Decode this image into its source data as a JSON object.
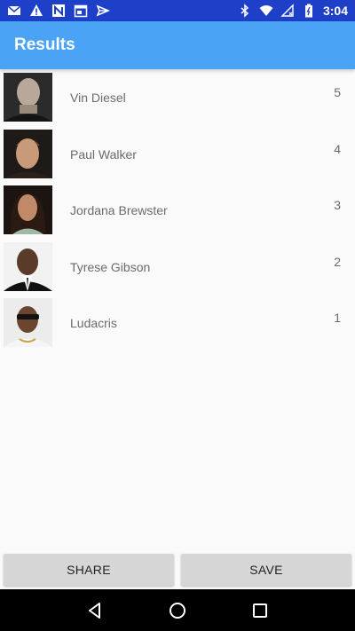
{
  "status_bar": {
    "time": "3:04",
    "left_icons": [
      "gmail-icon",
      "warning-icon",
      "n-app-icon",
      "calendar-icon",
      "send-icon"
    ],
    "right_icons": [
      "bluetooth-icon",
      "wifi-icon",
      "no-sim-icon",
      "battery-icon"
    ]
  },
  "app_bar": {
    "title": "Results"
  },
  "results": [
    {
      "name": "Vin Diesel",
      "rank": "5"
    },
    {
      "name": "Paul Walker",
      "rank": "4"
    },
    {
      "name": "Jordana Brewster",
      "rank": "3"
    },
    {
      "name": "Tyrese Gibson",
      "rank": "2"
    },
    {
      "name": "Ludacris",
      "rank": "1"
    }
  ],
  "buttons": {
    "share_label": "SHARE",
    "save_label": "SAVE"
  },
  "nav_bar": {
    "icons": [
      "back-icon",
      "home-icon",
      "recents-icon"
    ]
  },
  "colors": {
    "status_bar": "#1e40c8",
    "app_bar": "#4aa3f5",
    "background": "#fafafa",
    "button": "#d6d6d6"
  }
}
